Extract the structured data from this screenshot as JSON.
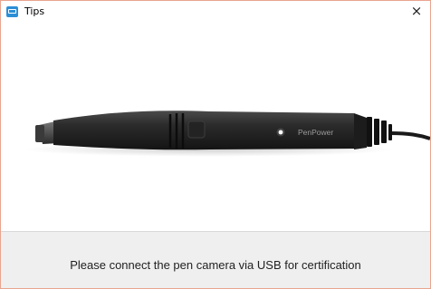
{
  "window": {
    "title": "Tips",
    "close_glyph": "×",
    "app_icon": "camera-app-icon"
  },
  "main": {
    "image": "pen-camera-image",
    "brand_text": "PenPower"
  },
  "footer": {
    "message": "Please connect the pen camera via USB for certification"
  },
  "colors": {
    "window_border": "#e8a48f",
    "footer_bg": "#efefef",
    "pen_body": "#2a2a2a",
    "indicator_led": "#ffffff"
  }
}
